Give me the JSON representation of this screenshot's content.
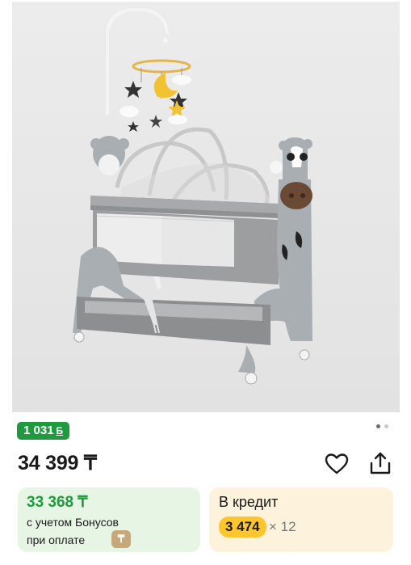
{
  "product": {
    "image_alt": "bedside crib with cow design",
    "bonus_badge": "1 031",
    "bonus_glyph": "Б",
    "price": "34 399 ₸",
    "carousel_dots": 2,
    "carousel_active": 0
  },
  "bonus_card": {
    "amount": "33 368 ₸",
    "line1": "с учетом Бонусов",
    "line2": "при оплате",
    "pay_icon": "kaspi-pay-icon"
  },
  "credit_card": {
    "title": "В кредит",
    "monthly": "3 474",
    "term": "× 12"
  },
  "icons": {
    "favorite": "heart-outline-icon",
    "share": "share-icon"
  },
  "colors": {
    "bonus_green": "#1f9a3f",
    "bonus_bg": "#e7f5e4",
    "credit_bg": "#fdf3dc",
    "credit_highlight": "#fdc62f"
  }
}
